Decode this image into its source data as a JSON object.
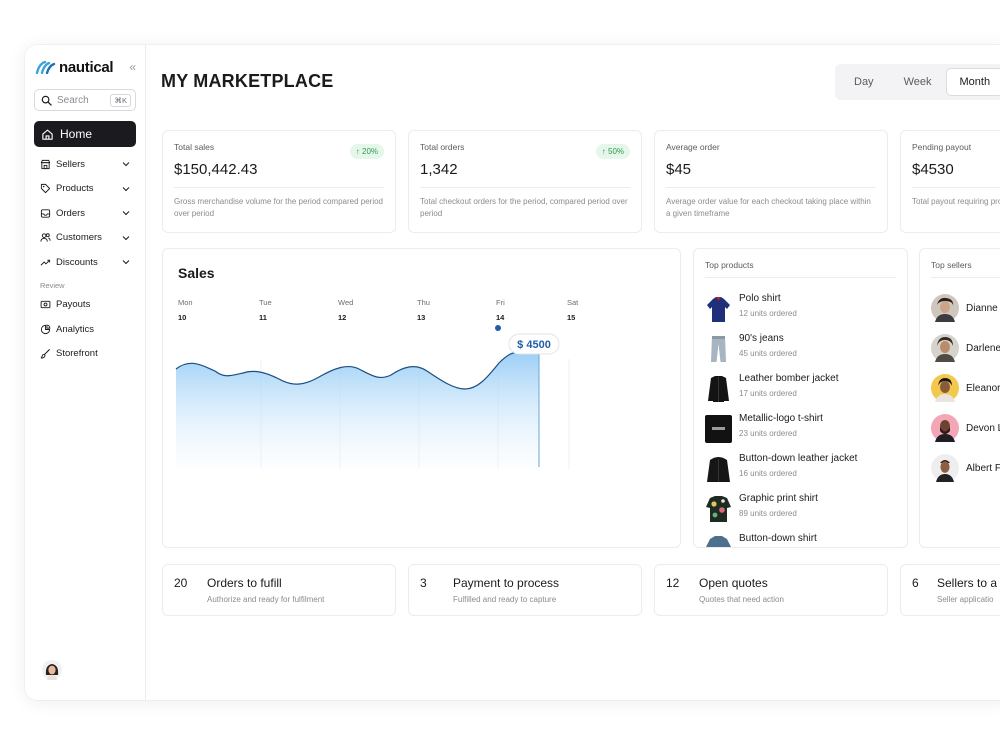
{
  "app": {
    "logo_text": "nautical",
    "collapse_glyph": "«",
    "brand_color": "#3aa3d8"
  },
  "sidebar": {
    "search_placeholder": "Search",
    "search_shortcut": "⌘K",
    "home_label": "Home",
    "items": [
      {
        "label": "Sellers",
        "icon": "store-icon",
        "has_chevron": true
      },
      {
        "label": "Products",
        "icon": "tag-icon",
        "has_chevron": true
      },
      {
        "label": "Orders",
        "icon": "inbox-icon",
        "has_chevron": true
      },
      {
        "label": "Customers",
        "icon": "users-icon",
        "has_chevron": true
      },
      {
        "label": "Discounts",
        "icon": "trend-icon",
        "has_chevron": true
      }
    ],
    "section_label": "Review",
    "review_items": [
      {
        "label": "Payouts",
        "icon": "cash-icon"
      },
      {
        "label": "Analytics",
        "icon": "pie-icon"
      },
      {
        "label": "Storefront",
        "icon": "brush-icon"
      }
    ]
  },
  "header": {
    "title": "MY MARKETPLACE",
    "range_options": [
      "Day",
      "Week",
      "Month"
    ],
    "range_selected": "Month"
  },
  "metrics": [
    {
      "label": "Total sales",
      "value": "$150,442.43",
      "badge": "↑ 20%",
      "desc": "Gross merchandise volume for the period compared period over period"
    },
    {
      "label": "Total orders",
      "value": "1,342",
      "badge": "↑ 50%",
      "desc": "Total checkout orders for the period, compared period over period"
    },
    {
      "label": "Average order",
      "value": "$45",
      "badge": "",
      "desc": "Average order value for each checkout taking place within a given timeframe"
    },
    {
      "label": "Pending payout",
      "value": "$4530",
      "badge": "",
      "desc": "Total payout requiring processing"
    }
  ],
  "sales": {
    "title": "Sales",
    "tooltip": "$ 4500"
  },
  "chart_data": {
    "type": "area",
    "title": "Sales",
    "x": [
      "Mon 10",
      "Tue 11",
      "Wed 12",
      "Thu 13",
      "Fri 14",
      "Sat 15"
    ],
    "days": [
      {
        "day": "Mon",
        "date": "10"
      },
      {
        "day": "Tue",
        "date": "11"
      },
      {
        "day": "Wed",
        "date": "12"
      },
      {
        "day": "Thu",
        "date": "13"
      },
      {
        "day": "Fri",
        "date": "14"
      },
      {
        "day": "Sat",
        "date": "15"
      }
    ],
    "highlight": {
      "x": "Fri 14",
      "value": 4500,
      "label": "$ 4500"
    },
    "line_color": "#4aa3df",
    "fill_color": "#a9d6f7"
  },
  "top_products": {
    "title": "Top products",
    "items": [
      {
        "name": "Polo shirt",
        "units": "12 units ordered",
        "thumb": "polo-shirt-thumbnail"
      },
      {
        "name": "90's jeans",
        "units": "45 units ordered",
        "thumb": "jeans-thumbnail"
      },
      {
        "name": "Leather bomber jacket",
        "units": "17 units ordered",
        "thumb": "bomber-jacket-thumbnail"
      },
      {
        "name": "Metallic-logo t-shirt",
        "units": "23 units ordered",
        "thumb": "tshirt-thumbnail"
      },
      {
        "name": "Button-down leather jacket",
        "units": "16 units ordered",
        "thumb": "leather-jacket-thumbnail"
      },
      {
        "name": "Graphic print shirt",
        "units": "89 units ordered",
        "thumb": "print-shirt-thumbnail"
      },
      {
        "name": "Button-down shirt",
        "units": "",
        "thumb": "button-shirt-thumbnail"
      }
    ]
  },
  "top_sellers": {
    "title": "Top sellers",
    "items": [
      {
        "name": "Dianne"
      },
      {
        "name": "Darlene"
      },
      {
        "name": "Eleanor"
      },
      {
        "name": "Devon L"
      },
      {
        "name": "Albert F"
      }
    ]
  },
  "tasks": [
    {
      "count": "20",
      "title": "Orders to fufill",
      "desc": "Authorize and ready for fulfilment"
    },
    {
      "count": "3",
      "title": "Payment to process",
      "desc": "Fulfilled and ready to capture"
    },
    {
      "count": "12",
      "title": "Open quotes",
      "desc": "Quotes that need action"
    },
    {
      "count": "6",
      "title": "Sellers to a",
      "desc": "Seller applicatio"
    }
  ]
}
